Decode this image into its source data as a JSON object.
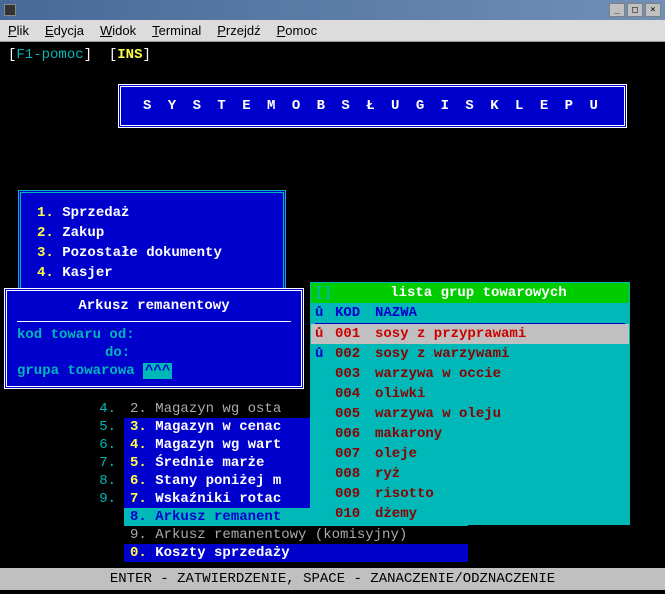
{
  "titlebar": {
    "text": ""
  },
  "menubar": {
    "items": [
      {
        "label": "Plik",
        "u": "P",
        "rest": "lik"
      },
      {
        "label": "Edycja",
        "u": "E",
        "rest": "dycja"
      },
      {
        "label": "Widok",
        "u": "W",
        "rest": "idok"
      },
      {
        "label": "Terminal",
        "u": "T",
        "rest": "erminal"
      },
      {
        "label": "Przejdź",
        "u": "P",
        "rest": "rzejdź"
      },
      {
        "label": "Pomoc",
        "u": "P",
        "rest": "omoc"
      }
    ]
  },
  "status": {
    "f1": "F1",
    "f1label": "-pomoc",
    "ins": "INS"
  },
  "banner": "S Y S T E M   O B S Ł U G I   S K L E P U",
  "menu1": {
    "items": [
      {
        "num": "1.",
        "label": "Sprzedaż"
      },
      {
        "num": "2.",
        "label": "Zakup"
      },
      {
        "num": "3.",
        "label": "Pozostałe dokumenty"
      },
      {
        "num": "4.",
        "label": "Kasjer"
      }
    ]
  },
  "form": {
    "title": "Arkusz remanentowy",
    "rows": [
      {
        "label": "kod towaru od:",
        "value": ""
      },
      {
        "label": "do:",
        "value": ""
      },
      {
        "label": "grupa towarowa",
        "value": "^^^"
      }
    ]
  },
  "menu2": {
    "items": [
      {
        "left": "4.",
        "num": "2.",
        "label": "Magazyn wg osta",
        "cls": "first"
      },
      {
        "left": "5.",
        "num": "3.",
        "label": "Magazyn w cenac"
      },
      {
        "left": "6.",
        "num": "4.",
        "label": "Magazyn wg wart"
      },
      {
        "left": "7.",
        "num": "5.",
        "label": "Średnie marże"
      },
      {
        "left": "8.",
        "num": "6.",
        "label": "Stany poniżej m"
      },
      {
        "left": "9.",
        "num": "7.",
        "label": "Wskaźniki rotac"
      },
      {
        "left": "",
        "num": "8.",
        "label": "Arkusz remanent",
        "cls": "sel"
      },
      {
        "left": "",
        "num": "9.",
        "label": "Arkusz remanentowy (komisyjny)",
        "cls": "grey"
      },
      {
        "left": "",
        "num": "0.",
        "label": "Koszty sprzedaży"
      }
    ]
  },
  "list": {
    "title": "lista grup towarowych",
    "header": {
      "mark": "ů",
      "kod": "KOD",
      "name": "NAZWA"
    },
    "rows": [
      {
        "mark": "ů",
        "kod": "001",
        "name": "sosy z przyprawami",
        "sel": true
      },
      {
        "mark": "ů",
        "kod": "002",
        "name": "sosy z warzywami"
      },
      {
        "mark": "",
        "kod": "003",
        "name": "warzywa w occie"
      },
      {
        "mark": "",
        "kod": "004",
        "name": "oliwki"
      },
      {
        "mark": "",
        "kod": "005",
        "name": "warzywa w oleju"
      },
      {
        "mark": "",
        "kod": "006",
        "name": "makarony"
      },
      {
        "mark": "",
        "kod": "007",
        "name": "oleje"
      },
      {
        "mark": "",
        "kod": "008",
        "name": "ryż"
      },
      {
        "mark": "",
        "kod": "009",
        "name": "risotto"
      },
      {
        "mark": "",
        "kod": "010",
        "name": "dżemy"
      }
    ]
  },
  "footer": "ENTER - ZATWIERDZENIE,    SPACE - ZANACZENIE/ODZNACZENIE"
}
